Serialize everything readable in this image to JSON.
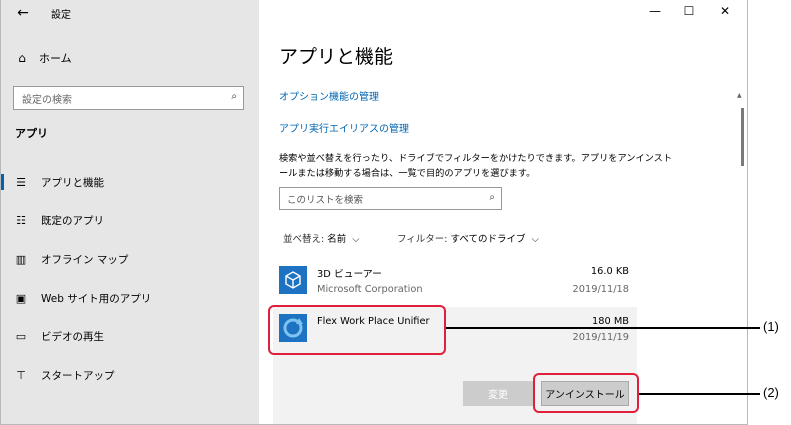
{
  "window": {
    "title": "設定"
  },
  "sidebar": {
    "home_label": "ホーム",
    "search_placeholder": "設定の検索",
    "section_title": "アプリ",
    "items": [
      {
        "label": "アプリと機能",
        "icon": "list-icon",
        "active": true
      },
      {
        "label": "既定のアプリ",
        "icon": "default-apps-icon"
      },
      {
        "label": "オフライン マップ",
        "icon": "map-icon"
      },
      {
        "label": "Web サイト用のアプリ",
        "icon": "website-icon"
      },
      {
        "label": "ビデオの再生",
        "icon": "video-icon"
      },
      {
        "label": "スタートアップ",
        "icon": "startup-icon"
      }
    ]
  },
  "main": {
    "title": "アプリと機能",
    "links": [
      "オプション機能の管理",
      "アプリ実行エイリアスの管理"
    ],
    "description": "検索や並べ替えを行ったり、ドライブでフィルターをかけたりできます。アプリをアンインストールまたは移動する場合は、一覧で目的のアプリを選びます。",
    "search_placeholder": "このリストを検索",
    "sort_label": "並べ替え:",
    "sort_value": "名前",
    "filter_label": "フィルター:",
    "filter_value": "すべてのドライブ",
    "apps": [
      {
        "name": "3D ビューアー",
        "publisher": "Microsoft Corporation",
        "size": "16.0 KB",
        "date": "2019/11/18"
      },
      {
        "name": "Flex Work Place Unifier",
        "publisher": "",
        "size": "180 MB",
        "date": "2019/11/19"
      }
    ],
    "buttons": {
      "change": "変更",
      "uninstall": "アンインストール"
    }
  },
  "callouts": [
    "(1)",
    "(2)"
  ],
  "colors": {
    "accent": "#0063b1",
    "link": "#0066b4",
    "highlight": "#e0203a"
  }
}
